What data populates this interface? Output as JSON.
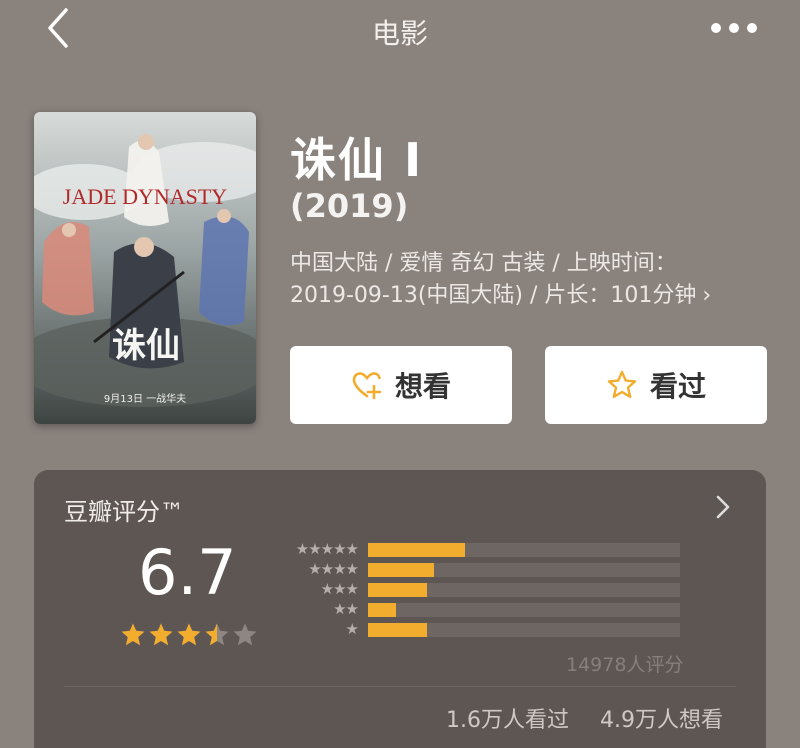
{
  "nav": {
    "title": "电影",
    "back_icon": "chevron-left-icon",
    "more_icon": "more-dots-icon"
  },
  "movie": {
    "title": "诛仙 I",
    "year": "(2019)",
    "meta_line1": "中国大陆 / 爱情 奇幻 古装 / 上映时间：",
    "meta_line2": "2019-09-13(中国大陆) / 片长：101分钟",
    "meta_chevron": "›",
    "poster": {
      "title_en": "JADE DYNASTY",
      "title_cn": "诛仙",
      "release_note": "9月13日 一战华夫"
    }
  },
  "actions": {
    "want_label": "想看",
    "want_icon": "heart-plus-icon",
    "seen_label": "看过",
    "seen_icon": "star-outline-icon"
  },
  "rating": {
    "header": "豆瓣评分™",
    "score": "6.7",
    "stars_value": 3.5,
    "distribution": [
      {
        "stars": "★★★★★",
        "fraction": 0.31
      },
      {
        "stars": "★★★★",
        "fraction": 0.21
      },
      {
        "stars": "★★★",
        "fraction": 0.19
      },
      {
        "stars": "★★",
        "fraction": 0.09
      },
      {
        "stars": "★",
        "fraction": 0.19
      }
    ],
    "raters": "14978人评分",
    "seen_count": "1.6万人看过",
    "want_count": "4.9万人想看"
  },
  "colors": {
    "background": "#8a827d",
    "card": "#5e5652",
    "accent": "#f2ac2e",
    "button": "#ffffff"
  }
}
